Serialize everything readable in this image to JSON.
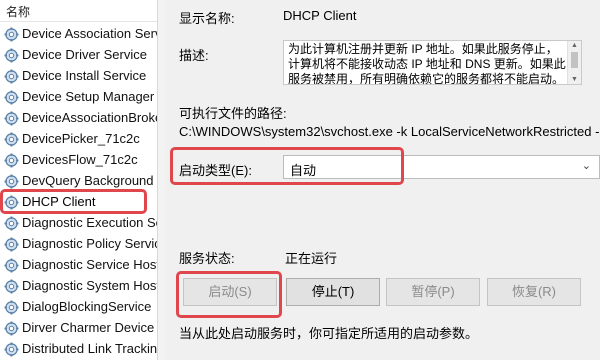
{
  "list": {
    "header": "名称",
    "items": [
      {
        "label": "Device Association Serv"
      },
      {
        "label": "Device Driver Service"
      },
      {
        "label": "Device Install Service"
      },
      {
        "label": "Device Setup Manager"
      },
      {
        "label": "DeviceAssociationBroke"
      },
      {
        "label": "DevicePicker_71c2c"
      },
      {
        "label": "DevicesFlow_71c2c"
      },
      {
        "label": "DevQuery Background"
      },
      {
        "label": "DHCP Client",
        "selected": true
      },
      {
        "label": "Diagnostic Execution Se"
      },
      {
        "label": "Diagnostic Policy Servic"
      },
      {
        "label": "Diagnostic Service Host"
      },
      {
        "label": "Diagnostic System Host"
      },
      {
        "label": "DialogBlockingService"
      },
      {
        "label": "Dirver Charmer Device"
      },
      {
        "label": "Distributed Link Trackin"
      }
    ]
  },
  "props": {
    "display_name_label": "显示名称:",
    "display_name_value": "DHCP Client",
    "description_label": "描述:",
    "description_text": "为此计算机注册并更新 IP 地址。如果此服务停止，计算机将不能接收动态 IP 地址和 DNS 更新。如果此服务被禁用，所有明确依赖它的服务都将不能启动。",
    "path_label": "可执行文件的路径:",
    "path_value": "C:\\WINDOWS\\system32\\svchost.exe -k LocalServiceNetworkRestricted -",
    "startup_type_label": "启动类型(E):",
    "startup_type_value": "自动",
    "status_label": "服务状态:",
    "status_value": "正在运行",
    "hint": "当从此处启动服务时，你可指定所适用的启动参数。"
  },
  "buttons": {
    "start": "启动(S)",
    "stop": "停止(T)",
    "pause": "暂停(P)",
    "resume": "恢复(R)"
  },
  "colors": {
    "highlight": "#e0474c",
    "pane_bg": "#f0f0f0"
  }
}
